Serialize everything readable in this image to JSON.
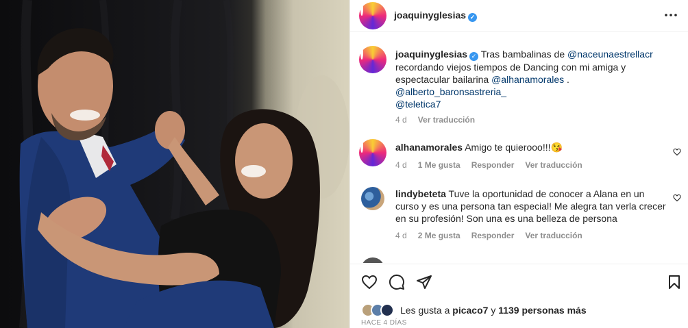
{
  "post": {
    "username": "joaquinyglesias",
    "verified_icon": "verified-badge-icon",
    "more_icon": "more-options-icon"
  },
  "caption": {
    "username": "joaquinyglesias",
    "text_1": "Tras bambalinas de",
    "mention_1": "@naceunaestrellacr",
    "text_2": "recordando viejos tiempos de Dancing con mi amiga y espectacular bailarina",
    "mention_2": "@alhanamorales",
    "text_3": ".",
    "mention_3": "@alberto_baronsastreria_",
    "mention_4": "@teletica7",
    "age": "4 d",
    "translate": "Ver traducción"
  },
  "comments": [
    {
      "username": "alhanamorales",
      "text": "Amigo te quierooo!!!😘",
      "age": "4 d",
      "likes": "1 Me gusta",
      "reply": "Responder",
      "translate": "Ver traducción"
    },
    {
      "username": "lindybeteta",
      "text": "Tuve la oportunidad de conocer a Alana en un curso y es una persona tan especial! Me alegra tan verla crecer en su profesión! Son una es una belleza de persona",
      "age": "4 d",
      "likes": "2 Me gusta",
      "reply": "Responder",
      "translate": "Ver traducción"
    }
  ],
  "actions": {
    "like_icon": "heart-icon",
    "comment_icon": "comment-icon",
    "share_icon": "share-icon",
    "save_icon": "bookmark-icon"
  },
  "likes": {
    "prefix": "Les gusta a",
    "user": "picaco7",
    "connector": "y",
    "others": "1139 personas más"
  },
  "date": "HACE 4 DÍAS",
  "colors": {
    "link": "#00376b",
    "verified": "#3897f0",
    "muted": "#8e8e8e",
    "text": "#262626"
  }
}
